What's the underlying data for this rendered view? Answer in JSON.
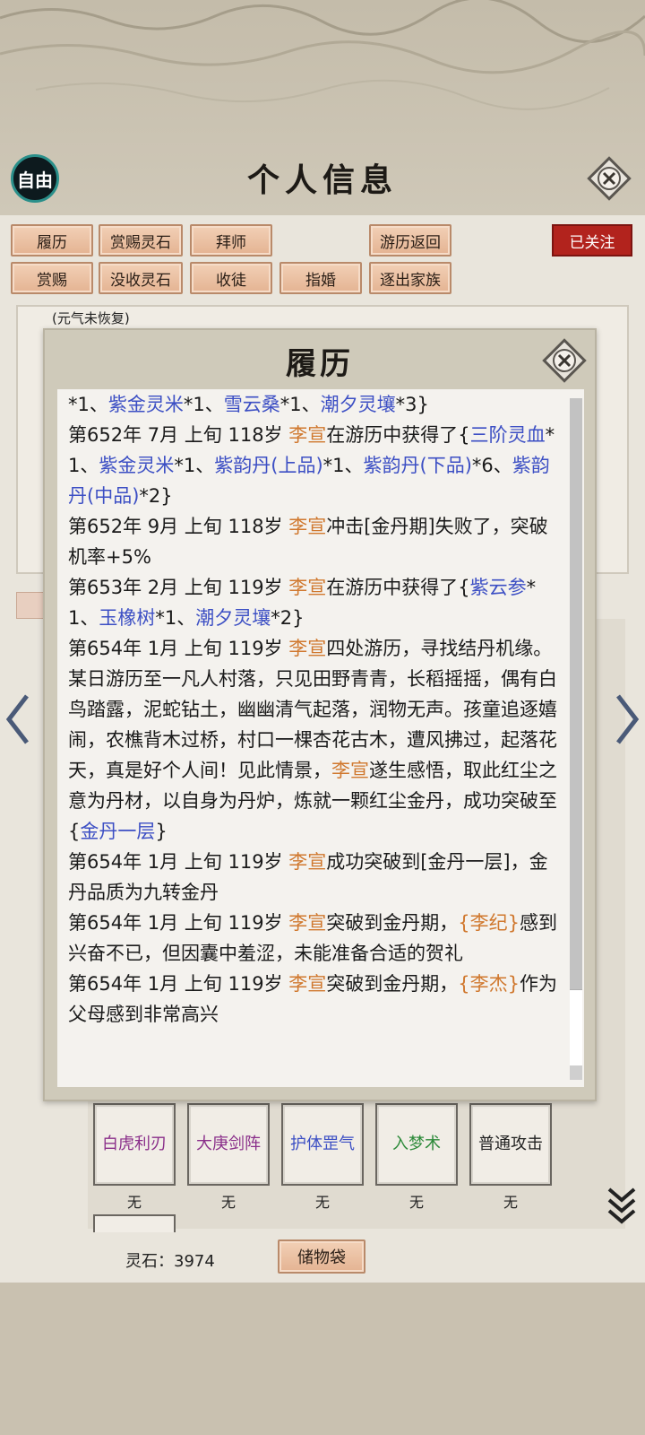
{
  "header": {
    "mode_badge": "自由",
    "title": "个人信息",
    "close_icon": "close-icon"
  },
  "actions": {
    "row1": [
      "履历",
      "赏赐灵石",
      "拜师",
      "游历返回"
    ],
    "row2": [
      "赏赐",
      "没收灵石",
      "收徒",
      "指婚",
      "逐出家族"
    ],
    "follow": "已关注"
  },
  "profile": {
    "status_tag": "(元气未恢复)"
  },
  "skills": [
    {
      "name": "白虎利刃",
      "color": "#8a2f8a",
      "level": "无"
    },
    {
      "name": "大庚剑阵",
      "color": "#8a2f8a",
      "level": "无"
    },
    {
      "name": "护体罡气",
      "color": "#3c4fc4",
      "level": "无"
    },
    {
      "name": "入梦术",
      "color": "#2d8a3a",
      "level": "无"
    },
    {
      "name": "普通攻击",
      "color": "#222222",
      "level": "无"
    }
  ],
  "footer": {
    "spirit_stone": "灵石：3974",
    "bag_button": "储物袋"
  },
  "modal": {
    "title": "履历",
    "close_icon": "close-icon",
    "entries": [
      [
        [
          "t",
          "*1、"
        ],
        [
          "i",
          "紫金灵米"
        ],
        [
          "t",
          "*1、"
        ],
        [
          "i",
          "雪云桑"
        ],
        [
          "t",
          "*1、"
        ],
        [
          "i",
          "潮夕灵壤"
        ],
        [
          "t",
          "*3}"
        ]
      ],
      [
        [
          "t",
          "第652年 7月 上旬  118岁  "
        ],
        [
          "n",
          "李宣"
        ],
        [
          "t",
          "在游历中获得了{"
        ],
        [
          "i",
          "三阶灵血"
        ],
        [
          "t",
          "*1、"
        ],
        [
          "i",
          "紫金灵米"
        ],
        [
          "t",
          "*1、"
        ],
        [
          "i",
          "紫韵丹(上品)"
        ],
        [
          "t",
          "*1、"
        ],
        [
          "i",
          "紫韵丹(下品)"
        ],
        [
          "t",
          "*6、"
        ],
        [
          "i",
          "紫韵丹(中品)"
        ],
        [
          "t",
          "*2}"
        ]
      ],
      [
        [
          "t",
          "第652年 9月 上旬  118岁  "
        ],
        [
          "n",
          "李宣"
        ],
        [
          "t",
          "冲击[金丹期]失败了，突破机率+5%"
        ]
      ],
      [
        [
          "t",
          "第653年 2月 上旬  119岁  "
        ],
        [
          "n",
          "李宣"
        ],
        [
          "t",
          "在游历中获得了{"
        ],
        [
          "i",
          "紫云参"
        ],
        [
          "t",
          "*1、"
        ],
        [
          "i",
          "玉橡树"
        ],
        [
          "t",
          "*1、"
        ],
        [
          "i",
          "潮夕灵壤"
        ],
        [
          "t",
          "*2}"
        ]
      ],
      [
        [
          "t",
          "第654年 1月 上旬  119岁  "
        ],
        [
          "n",
          "李宣"
        ],
        [
          "t",
          "四处游历，寻找结丹机缘。某日游历至一凡人村落，只见田野青青，长稻摇摇，偶有白鸟踏露，泥蛇钻土，幽幽清气起落，润物无声。孩童追逐嬉闹，农樵背木过桥，村口一棵杏花古木，遭风拂过，起落花天，真是好个人间！见此情景，"
        ],
        [
          "n",
          "李宣"
        ],
        [
          "t",
          "遂生感悟，取此红尘之意为丹材，以自身为丹炉，炼就一颗红尘金丹，成功突破至{"
        ],
        [
          "i",
          "金丹一层"
        ],
        [
          "t",
          "}"
        ]
      ],
      [
        [
          "t",
          "第654年 1月 上旬 119岁 "
        ],
        [
          "n",
          "李宣"
        ],
        [
          "t",
          "成功突破到[金丹一层]，金丹品质为九转金丹"
        ]
      ],
      [
        [
          "t",
          "第654年 1月 上旬 119岁 "
        ],
        [
          "n",
          "李宣"
        ],
        [
          "t",
          "突破到金丹期，"
        ],
        [
          "n",
          "{李纪}"
        ],
        [
          "t",
          "感到兴奋不已，但因囊中羞涩，未能准备合适的贺礼"
        ]
      ],
      [
        [
          "t",
          "第654年 1月 上旬 119岁 "
        ],
        [
          "n",
          "李宣"
        ],
        [
          "t",
          "突破到金丹期，"
        ],
        [
          "n",
          "{李杰}"
        ],
        [
          "t",
          "作为父母感到非常高兴"
        ]
      ]
    ]
  }
}
